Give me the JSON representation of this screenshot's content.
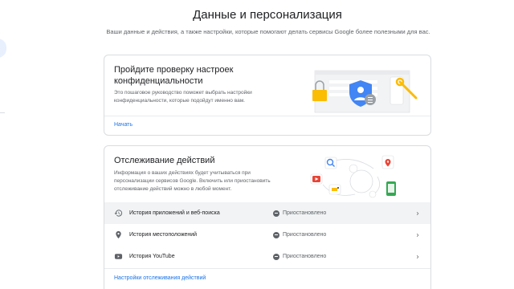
{
  "page": {
    "title": "Данные и персонализация",
    "subtitle": "Ваши данные и действия, а также настройки, которые помогают делать сервисы Google более полезными для вас."
  },
  "privacy_checkup": {
    "title": "Пройдите проверку настроек конфиденциальности",
    "description": "Это пошаговое руководство поможет выбрать настройки конфиденциальности, которые подойдут именно вам.",
    "link": "Начать"
  },
  "activity_controls": {
    "title": "Отслеживание действий",
    "description": "Информация о ваших действиях будет учитываться при персонализации сервисов Google. Включить или приостановить отслеживание действий можно в любой момент.",
    "rows": [
      {
        "label": "История приложений и веб-поиска",
        "status": "Приостановлено",
        "icon": "history-icon"
      },
      {
        "label": "История местоположений",
        "status": "Приостановлено",
        "icon": "location-pin-icon"
      },
      {
        "label": "История YouTube",
        "status": "Приостановлено",
        "icon": "youtube-icon"
      }
    ],
    "link": "Настройки отслеживания действий"
  },
  "colors": {
    "accent": "#1a73e8",
    "status": "#5f6368",
    "border": "#dadce0",
    "highlight_row": "#f1f3f4"
  }
}
